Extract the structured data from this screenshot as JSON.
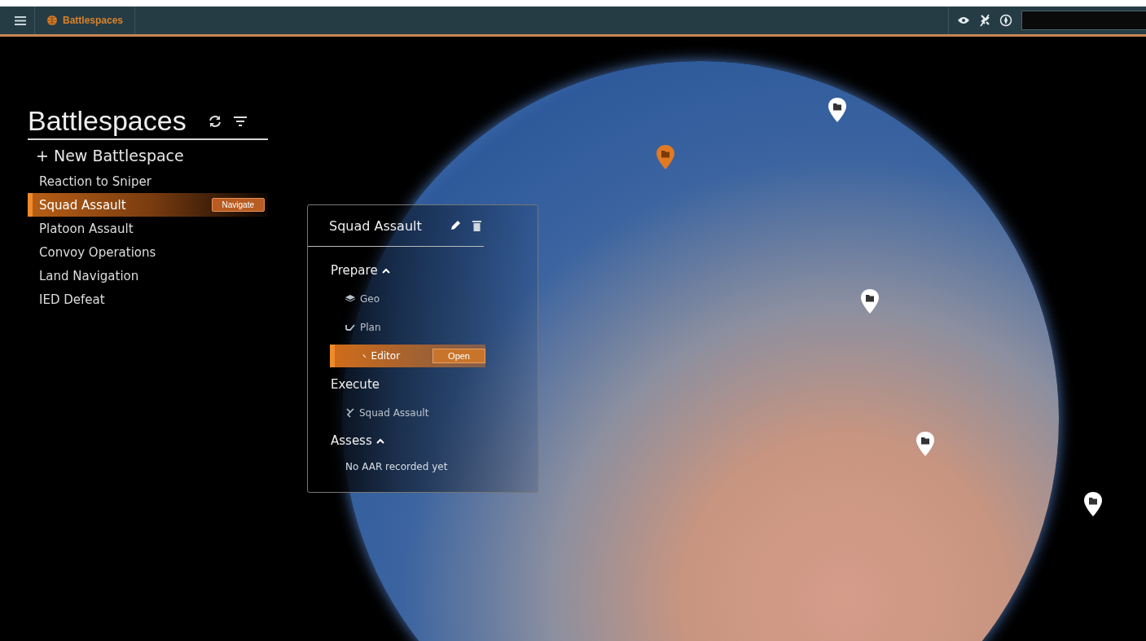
{
  "app_bar": {
    "tab_label": "Battlespaces"
  },
  "sidebar": {
    "title": "Battlespaces",
    "new_button": "+ New Battlespace",
    "items": [
      {
        "label": "Reaction to Sniper",
        "selected": false
      },
      {
        "label": "Squad Assault",
        "selected": true,
        "action": "Navigate"
      },
      {
        "label": "Platoon Assault",
        "selected": false
      },
      {
        "label": "Convoy Operations",
        "selected": false
      },
      {
        "label": "Land Navigation",
        "selected": false
      },
      {
        "label": "IED Defeat",
        "selected": false
      }
    ]
  },
  "map_pins": [
    {
      "selected": false
    },
    {
      "selected": true
    },
    {
      "selected": false
    },
    {
      "selected": false
    },
    {
      "selected": false
    }
  ],
  "detail_panel": {
    "title": "Squad Assault",
    "sections": [
      {
        "label": "Prepare",
        "kind": "collapsible",
        "expanded": true,
        "items": [
          {
            "label": "Geo",
            "kind": "geo",
            "selected": false
          },
          {
            "label": "Plan",
            "kind": "plan",
            "selected": false
          },
          {
            "label": "Editor",
            "kind": "editor",
            "selected": true,
            "action": "Open"
          }
        ]
      },
      {
        "label": "Execute",
        "kind": "fixed",
        "items": [
          {
            "label": "Squad Assault",
            "kind": "scenario",
            "selected": false
          }
        ]
      },
      {
        "label": "Assess",
        "kind": "collapsible",
        "expanded": true,
        "note": "No AAR recorded yet"
      }
    ]
  }
}
